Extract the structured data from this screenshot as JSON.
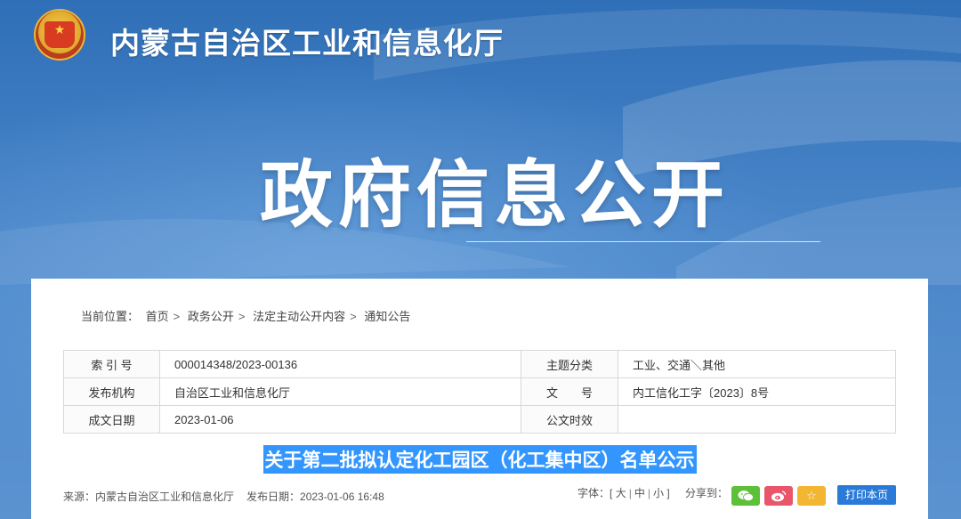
{
  "header": {
    "site_title": "内蒙古自治区工业和信息化厅",
    "hero_title": "政府信息公开"
  },
  "breadcrumb": {
    "label": "当前位置：",
    "items": [
      "首页",
      "政务公开",
      "法定主动公开内容",
      "通知公告"
    ]
  },
  "meta_table": {
    "rows": [
      {
        "k1": "索 引 号",
        "v1": "000014348/2023-00136",
        "k2": "主题分类",
        "v2": "工业、交通＼其他"
      },
      {
        "k1": "发布机构",
        "v1": "自治区工业和信息化厅",
        "k2": "文　　号",
        "v2": "内工信化工字〔2023〕8号"
      },
      {
        "k1": "成文日期",
        "v1": "2023-01-06",
        "k2": "公文时效",
        "v2": ""
      }
    ]
  },
  "document": {
    "title": "关于第二批拟认定化工园区（化工集中区）名单公示"
  },
  "footer": {
    "source": "来源：内蒙古自治区工业和信息化厅",
    "publish": "发布日期：2023-01-06 16:48",
    "font_label": "字体：[",
    "font_large": "大",
    "font_medium": "中",
    "font_small": "小",
    "font_close": "]",
    "share_label": "分享到：",
    "print_label": "打印本页"
  },
  "colors": {
    "highlight": "#3396ff",
    "wechat": "#5cc139",
    "weibo": "#e9566b",
    "favorite": "#f2b632",
    "print": "#2a7ad8"
  },
  "icons": {
    "emblem": "national-emblem-icon",
    "wechat": "wechat-icon",
    "weibo": "weibo-icon",
    "favorite": "star-icon"
  }
}
